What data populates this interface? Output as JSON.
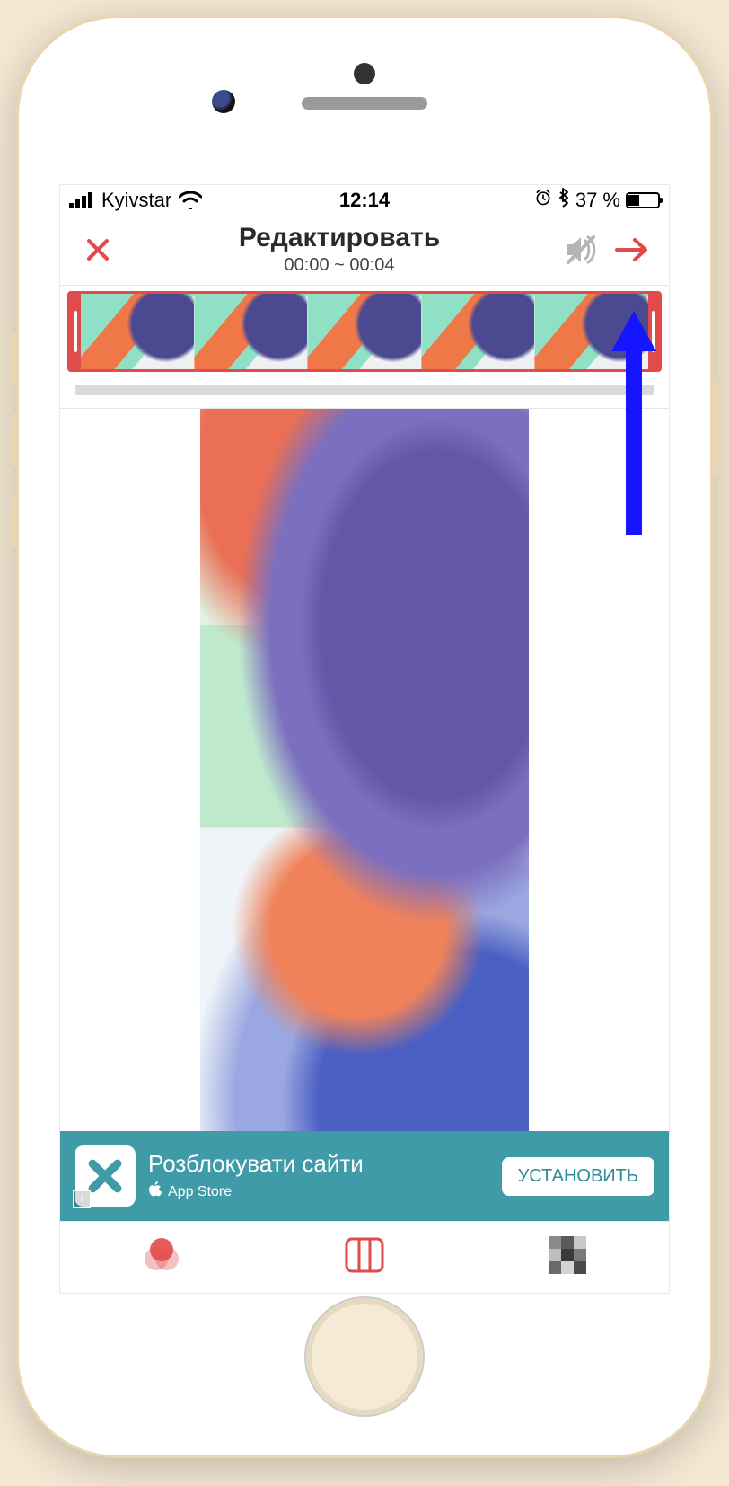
{
  "status": {
    "carrier": "Kyivstar",
    "time": "12:14",
    "battery_pct": "37 %",
    "battery_level": 37
  },
  "header": {
    "title": "Редактировать",
    "subtitle": "00:00 ~ 00:04"
  },
  "ad": {
    "title": "Розблокувати сайти",
    "store": "App Store",
    "cta": "УСТАНОВИТЬ",
    "badge": "i"
  },
  "colors": {
    "accent": "#e24b4b",
    "adbg": "#3f9ba7",
    "annotation": "#1515ff"
  },
  "icons": {
    "close": "close-icon",
    "mute": "mute-icon",
    "next": "arrow-right-icon",
    "alarm": "alarm-icon",
    "bluetooth": "bluetooth-icon",
    "wifi": "wifi-icon",
    "signal": "signal-icon",
    "apple": "apple-logo-icon",
    "filters": "filters-icon",
    "layout": "layout-icon",
    "pixelate": "pixelate-icon"
  }
}
